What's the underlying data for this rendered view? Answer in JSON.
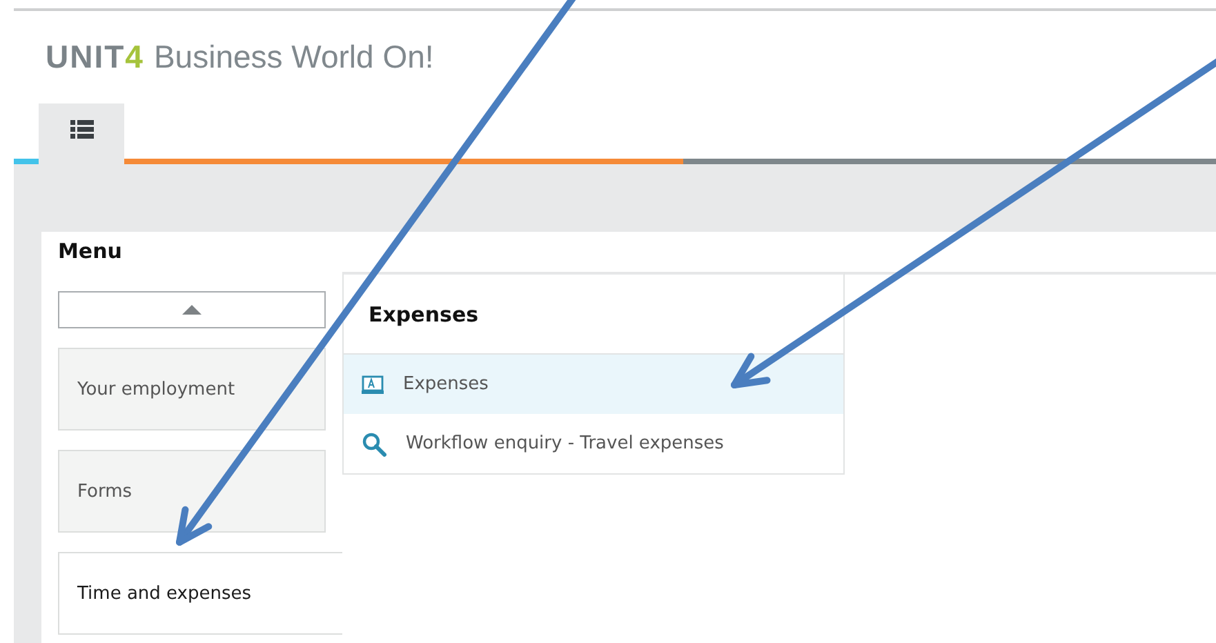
{
  "logo": {
    "brand": "UNIT",
    "brand_accent": "4",
    "product": "Business World On!"
  },
  "tabs": [
    {
      "selected": true
    }
  ],
  "menu": {
    "title": "Menu",
    "categories": [
      {
        "label": "Your employment",
        "selected": false
      },
      {
        "label": "Forms",
        "selected": false
      },
      {
        "label": "Time and expenses",
        "selected": true
      }
    ]
  },
  "submenu": {
    "title": "Expenses",
    "items": [
      {
        "kind": "form",
        "label": "Expenses",
        "selected": true
      },
      {
        "kind": "search",
        "label": "Workflow enquiry - Travel expenses",
        "selected": false
      }
    ]
  }
}
